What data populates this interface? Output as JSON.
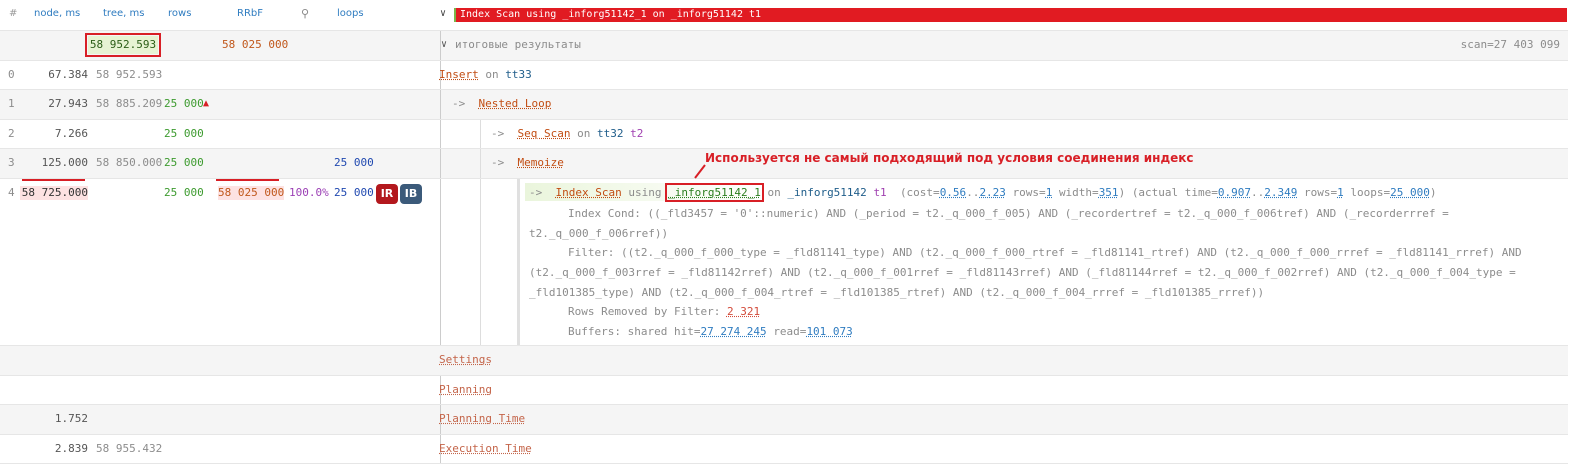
{
  "header": {
    "col_num": "#",
    "col_node": "node, ms",
    "col_tree": "tree, ms",
    "col_rows": "rows",
    "col_rrbf": "RRbF",
    "col_loops": "loops",
    "banner": "Index Scan using _inforg51142_1 on _inforg51142 t1"
  },
  "summary": {
    "tree_ms": "58 952.593",
    "rrbf": "58 025 000",
    "label": "итоговые результаты",
    "scan": "scan=27 403 099"
  },
  "rows": [
    {
      "id": "0",
      "node_ms": "67.384",
      "tree_ms": "58 952.593",
      "rows": "",
      "loops": "",
      "node": "Insert",
      "on": "on",
      "table": "tt33",
      "alias": ""
    },
    {
      "id": "1",
      "node_ms": "27.943",
      "tree_ms": "58 885.209",
      "rows": "25 000",
      "loops": "",
      "node": "Nested Loop",
      "arrow": "->"
    },
    {
      "id": "2",
      "node_ms": "7.266",
      "tree_ms": "",
      "rows": "25 000",
      "loops": "",
      "node": "Seq Scan",
      "on": "on",
      "table": "tt32",
      "alias": "t2",
      "arrow": "->"
    },
    {
      "id": "3",
      "node_ms": "125.000",
      "tree_ms": "58 850.000",
      "rows": "25 000",
      "loops": "25 000",
      "node": "Memoize",
      "arrow": "->"
    },
    {
      "id": "4",
      "node_ms": "58 725.000",
      "tree_ms": "",
      "rows": "25 000",
      "rrbf": "58 025 000",
      "pct": "100.0%",
      "loops": "25 000",
      "node": "Index Scan",
      "arrow": "->",
      "using": "using",
      "index": "_inforg51142_1",
      "on": "on",
      "table": "_inforg51142",
      "alias": "t1",
      "badge_ir": "IR",
      "badge_ib": "IB",
      "cost_a": "0.56",
      "cost_b": "2.23",
      "rows_est": "1",
      "width": "351",
      "time_a": "0.907",
      "time_b": "2.349",
      "rows_act": "1",
      "loops_act": "25 000",
      "index_cond": "Index Cond: ((_fld3457 = '0'::numeric) AND (_period = t2._q_000_f_005) AND (_recordertref = t2._q_000_f_006tref) AND (_recorderrref = t2._q_000_f_006rref))",
      "filter": "Filter: ((t2._q_000_f_000_type = _fld81141_type) AND (t2._q_000_f_000_rtref = _fld81141_rtref) AND (t2._q_000_f_000_rrref = _fld81141_rrref) AND (t2._q_000_f_003rref = _fld81142rref) AND (t2._q_000_f_001rref = _fld81143rref) AND (_fld81144rref = t2._q_000_f_002rref) AND (t2._q_000_f_004_type = _fld101385_type) AND (t2._q_000_f_004_rtref = _fld101385_rtref) AND (t2._q_000_f_004_rrref = _fld101385_rrref))",
      "rows_removed_label": "Rows Removed by Filter:",
      "rows_removed": "2 321",
      "buffers_label": "Buffers: shared hit=",
      "hit": "27 274 245",
      "read_label": "read=",
      "read": "101 073"
    }
  ],
  "annotation": "Используется не самый подходящий под условия соединения индекс",
  "footer": [
    {
      "label": "Settings",
      "node_ms": "",
      "tree_ms": ""
    },
    {
      "label": "Planning",
      "node_ms": "",
      "tree_ms": ""
    },
    {
      "label": "Planning Time",
      "node_ms": "1.752",
      "tree_ms": ""
    },
    {
      "label": "Execution Time",
      "node_ms": "2.839",
      "tree_ms": "58 955.432"
    }
  ],
  "colors": {
    "accent": "#d81f26",
    "link": "#2f7cc0",
    "node": "#c24d13",
    "badge_ir": "#b3181d",
    "badge_ib": "#3b5a7a"
  }
}
